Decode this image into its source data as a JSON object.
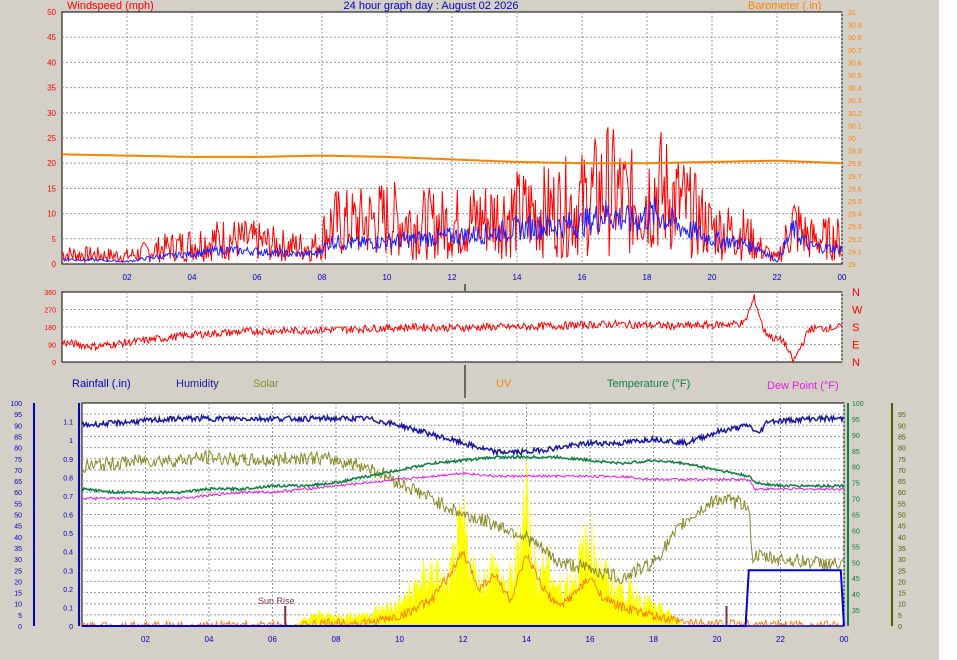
{
  "header": {
    "title": "24 hour graph day : August 02 2026",
    "left_label": "Windspeed (mph)",
    "right_label": "Barometer (.in)"
  },
  "panel_labels": {
    "rainfall": "Rainfall (.in)",
    "humidity": "Humidity",
    "solar": "Solar",
    "uv": "UV",
    "temperature": "Temperature (°F)",
    "dew_point": "Dew Point (°F)"
  },
  "annotations": {
    "sunrise": "Sun Rise"
  },
  "colors": {
    "panel_bg": "#ffffff",
    "frame_bg": "#d4d0c8",
    "grid": "#9a9a9a",
    "wind_speed": "#ff0000",
    "wind_avg": "#1f1fff",
    "barometer": "#ff8000",
    "direction": "#ff0000",
    "humidity": "#1a1a9e",
    "solar": "#8a8a2a",
    "uv": "#ff8000",
    "solar_fill": "#ffff00",
    "temperature": "#108040",
    "dew_point": "#e020e0",
    "rainfall": "#0000e0",
    "sunrise": "#803040",
    "left_axis_top": "#ff0000",
    "right_axis_top": "#ff8000",
    "blue_axis": "#0000c0",
    "right_axis_bottom": "#5a5a00"
  },
  "chart_data": [
    {
      "id": "wind_barometer",
      "type": "line",
      "title": "24 hour graph day : August 02 2026",
      "x_ticks": [
        "02",
        "04",
        "06",
        "08",
        "10",
        "12",
        "14",
        "16",
        "18",
        "20",
        "22",
        "00"
      ],
      "xlim": [
        0,
        24
      ],
      "ylabel_left": "Windspeed (mph)",
      "ylim_left": [
        0,
        50
      ],
      "y_ticks_left": [
        "0",
        "5",
        "10",
        "15",
        "20",
        "25",
        "30",
        "35",
        "40",
        "45",
        "50"
      ],
      "ylabel_right": "Barometer (.in)",
      "ylim_right": [
        29,
        31
      ],
      "y_ticks_right": [
        "29",
        "29.1",
        "29.2",
        "29.3",
        "29.4",
        "29.5",
        "29.6",
        "29.7",
        "29.8",
        "29.9",
        "30",
        "30.1",
        "30.2",
        "30.3",
        "30.4",
        "30.5",
        "30.6",
        "30.7",
        "30.8",
        "30.9",
        "31"
      ],
      "grid": true,
      "series": [
        {
          "name": "Windspeed (mph)",
          "key": "wind_speed",
          "axis": "left",
          "x": [
            0,
            1,
            2,
            3,
            4,
            5,
            6,
            7,
            7.8,
            8.3,
            9,
            10,
            11,
            12,
            13,
            14,
            15,
            16,
            16.8,
            17.5,
            18.3,
            19,
            20,
            21,
            21.5,
            22,
            22.5,
            23,
            24
          ],
          "y": [
            2,
            1.8,
            1.6,
            3,
            4,
            5,
            4.5,
            3.5,
            3.5,
            8,
            8,
            9,
            8,
            8,
            9,
            10,
            10.5,
            12,
            15,
            12,
            15,
            12,
            7,
            6,
            3,
            1,
            8,
            5,
            5
          ]
        },
        {
          "name": "Wind average",
          "key": "wind_avg",
          "axis": "left",
          "x": [
            0,
            1,
            2,
            3,
            4,
            5,
            6,
            7,
            7.8,
            8.3,
            9,
            10,
            11,
            12,
            13,
            14,
            15,
            16,
            16.8,
            17.5,
            18.3,
            19,
            20,
            21,
            21.5,
            22,
            22.5,
            23,
            24
          ],
          "y": [
            1,
            0.8,
            0.5,
            1.5,
            2,
            2.8,
            2.5,
            2,
            2,
            4.5,
            4,
            4.5,
            5,
            5.5,
            6,
            7,
            7.5,
            8,
            10,
            8.5,
            10,
            7.5,
            5,
            4,
            3,
            0.5,
            7,
            3.5,
            3
          ]
        },
        {
          "name": "Barometer (.in)",
          "key": "barometer",
          "axis": "right",
          "x": [
            0,
            2,
            4,
            6,
            8,
            10,
            12,
            14,
            16,
            18,
            20,
            22,
            24
          ],
          "y": [
            29.87,
            29.86,
            29.85,
            29.85,
            29.86,
            29.85,
            29.83,
            29.81,
            29.8,
            29.8,
            29.81,
            29.82,
            29.8
          ]
        }
      ]
    },
    {
      "id": "wind_direction",
      "type": "line",
      "x_ticks": [
        "02",
        "04",
        "06",
        "08",
        "10",
        "12",
        "14",
        "16",
        "18",
        "20",
        "22",
        "00"
      ],
      "xlim": [
        0,
        24
      ],
      "ylim": [
        0,
        360
      ],
      "y_ticks": [
        "0",
        "90",
        "180",
        "270",
        "360"
      ],
      "compass_labels": [
        "N",
        "W",
        "S",
        "E",
        "N"
      ],
      "grid": true,
      "series": [
        {
          "name": "Wind direction",
          "key": "direction",
          "x": [
            0,
            1,
            2,
            3,
            4,
            5,
            6,
            7,
            8,
            9,
            10,
            11,
            12,
            13,
            14,
            15,
            16,
            17,
            18,
            19,
            20,
            21,
            21.3,
            21.6,
            21.9,
            22.2,
            22.5,
            23,
            24
          ],
          "y": [
            100,
            80,
            100,
            120,
            140,
            150,
            160,
            160,
            165,
            170,
            175,
            180,
            175,
            180,
            180,
            185,
            190,
            195,
            190,
            185,
            190,
            200,
            330,
            160,
            120,
            110,
            0,
            170,
            180
          ]
        }
      ]
    },
    {
      "id": "temp_humidity_solar",
      "type": "area",
      "x_ticks": [
        "02",
        "04",
        "06",
        "08",
        "10",
        "12",
        "14",
        "16",
        "18",
        "20",
        "22",
        "00"
      ],
      "xlim": [
        0,
        24
      ],
      "ylabel_left_outer": "Humidity",
      "y_ticks_left_outer": [
        "0",
        "5",
        "10",
        "15",
        "20",
        "25",
        "30",
        "35",
        "40",
        "45",
        "50",
        "55",
        "60",
        "65",
        "70",
        "75",
        "80",
        "85",
        "90",
        "95",
        "100"
      ],
      "ylabel_left_inner": "Rainfall (.in)",
      "ylim_rain": [
        0,
        1.2
      ],
      "y_ticks_left_inner": [
        "0",
        "0.1",
        "0.2",
        "0.3",
        "0.4",
        "0.5",
        "0.6",
        "0.7",
        "0.8",
        "0.9",
        "1",
        "1.1"
      ],
      "ylabel_right_inner": "Temperature (°F)",
      "ylim_temp": [
        30,
        100
      ],
      "y_ticks_right_inner": [
        "35",
        "40",
        "45",
        "50",
        "55",
        "60",
        "65",
        "70",
        "75",
        "80",
        "85",
        "90",
        "95",
        "100"
      ],
      "y_ticks_right_outer": [
        "0",
        "5",
        "10",
        "15",
        "20",
        "25",
        "30",
        "35",
        "40",
        "45",
        "50",
        "55",
        "60",
        "65",
        "70",
        "75",
        "80",
        "85",
        "90",
        "95"
      ],
      "sunrise_hour": 6.4,
      "sunset_hour": 20.3,
      "grid": true,
      "series": [
        {
          "name": "Humidity",
          "key": "humidity",
          "scale": "pct",
          "x": [
            0,
            1,
            2,
            3,
            4,
            5,
            6,
            7,
            8,
            9,
            10,
            11,
            12,
            13,
            14,
            15,
            16,
            17,
            18,
            19,
            20,
            21,
            21.3,
            21.6,
            22,
            23,
            24
          ],
          "y": [
            90,
            91,
            92,
            93,
            93,
            93,
            93,
            93,
            93,
            93,
            90,
            86,
            82,
            78,
            78,
            80,
            82,
            82,
            84,
            82,
            87,
            90,
            86,
            92,
            92,
            93,
            93
          ]
        },
        {
          "name": "Solar",
          "key": "solar",
          "scale": "temp",
          "x": [
            0,
            1,
            2,
            3,
            4,
            5,
            6,
            7,
            8,
            9,
            10,
            11,
            12,
            13,
            14,
            15,
            16,
            17,
            18,
            19,
            20,
            21,
            21.1,
            22,
            23,
            24
          ],
          "y": [
            80,
            81,
            82,
            82,
            83,
            82,
            82,
            83,
            82,
            80,
            75,
            70,
            65,
            62,
            58,
            50,
            48,
            45,
            50,
            63,
            70,
            68,
            52,
            51,
            50,
            49
          ]
        },
        {
          "name": "Temperature (°F)",
          "key": "temperature",
          "scale": "temp",
          "x": [
            0,
            1,
            2,
            3,
            4,
            5,
            6,
            7,
            8,
            9,
            10,
            11,
            12,
            13,
            14,
            15,
            16,
            17,
            18,
            19,
            20,
            21,
            21.2,
            22,
            23,
            24
          ],
          "y": [
            73,
            72,
            72,
            72,
            73,
            73,
            74,
            74,
            75,
            77,
            79,
            81,
            82,
            83,
            83,
            83,
            82,
            81,
            82,
            81,
            79,
            77,
            75,
            74,
            74,
            74
          ]
        },
        {
          "name": "Dew Point (°F)",
          "key": "dew_point",
          "scale": "temp",
          "x": [
            0,
            1,
            2,
            3,
            4,
            5,
            6,
            7,
            8,
            9,
            10,
            11,
            12,
            13,
            14,
            15,
            16,
            17,
            18,
            19,
            20,
            21,
            21.2,
            22,
            23,
            24
          ],
          "y": [
            70,
            70,
            70,
            70,
            71,
            72,
            72,
            73,
            74,
            75,
            76,
            77,
            78,
            77,
            77,
            77,
            77,
            77,
            76,
            76,
            76,
            76,
            73,
            73,
            73,
            73
          ]
        },
        {
          "name": "UV",
          "key": "uv",
          "scale": "temp",
          "x": [
            0,
            7,
            8,
            9,
            10,
            11,
            11.5,
            12,
            12.5,
            13,
            13.5,
            14,
            14.5,
            15,
            15.5,
            16,
            16.5,
            17,
            18,
            19,
            24
          ],
          "y": [
            30,
            30,
            31,
            31,
            33,
            38,
            45,
            53,
            42,
            46,
            38,
            52,
            42,
            36,
            40,
            45,
            38,
            36,
            33,
            31,
            30
          ]
        },
        {
          "name": "Solar fill",
          "key": "solar_fill",
          "scale": "temp",
          "x": [
            0,
            6.6,
            7,
            7.5,
            8,
            9,
            10,
            10.5,
            11,
            11.5,
            12,
            12.3,
            12.6,
            13,
            13.3,
            13.6,
            14,
            14.3,
            14.6,
            15,
            15.5,
            16,
            16.3,
            16.6,
            17,
            17.5,
            18,
            18.5,
            19,
            24
          ],
          "y": [
            30,
            30,
            32,
            34,
            33,
            34,
            37,
            42,
            48,
            42,
            62,
            48,
            44,
            50,
            42,
            46,
            74,
            46,
            50,
            42,
            46,
            58,
            50,
            44,
            42,
            40,
            36,
            34,
            30,
            30
          ]
        },
        {
          "name": "Rainfall (.in)",
          "key": "rainfall",
          "scale": "rain",
          "x": [
            0,
            20.9,
            21,
            23.9,
            24
          ],
          "y": [
            0,
            0,
            0.3,
            0.3,
            0
          ]
        }
      ]
    }
  ]
}
